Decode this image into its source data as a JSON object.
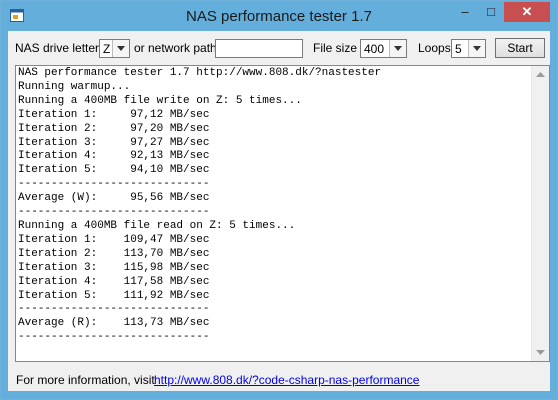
{
  "window": {
    "title": "NAS performance tester 1.7",
    "minimize": "–",
    "maximize": "□",
    "close": "✕"
  },
  "toolbar": {
    "drive_label": "NAS drive letter",
    "drive_value": "Z",
    "network_label": "or network path",
    "network_value": "",
    "filesize_label": "File size",
    "filesize_value": "400",
    "loops_label": "Loops",
    "loops_value": "5",
    "start_label": "Start"
  },
  "output_lines": [
    "NAS performance tester 1.7 http://www.808.dk/?nastester",
    "Running warmup...",
    "Running a 400MB file write on Z: 5 times...",
    "Iteration 1:     97,12 MB/sec",
    "Iteration 2:     97,20 MB/sec",
    "Iteration 3:     97,27 MB/sec",
    "Iteration 4:     92,13 MB/sec",
    "Iteration 5:     94,10 MB/sec",
    "-----------------------------",
    "Average (W):     95,56 MB/sec",
    "-----------------------------",
    "Running a 400MB file read on Z: 5 times...",
    "Iteration 1:    109,47 MB/sec",
    "Iteration 2:    113,70 MB/sec",
    "Iteration 3:    115,98 MB/sec",
    "Iteration 4:    117,58 MB/sec",
    "Iteration 5:    111,92 MB/sec",
    "-----------------------------",
    "Average (R):    113,73 MB/sec",
    "-----------------------------"
  ],
  "footer": {
    "info_label": "For more information, visit",
    "link_text": "http://www.808.dk/?code-csharp-nas-performance"
  },
  "icons": {
    "app": "app-window-icon",
    "dropdown": "chevron-down-icon",
    "scroll_up": "scroll-up-arrow-icon",
    "scroll_down": "scroll-down-arrow-icon"
  },
  "colors": {
    "titlebar": "#64aedc",
    "close_button": "#c74f4f",
    "link": "#0000ee"
  }
}
